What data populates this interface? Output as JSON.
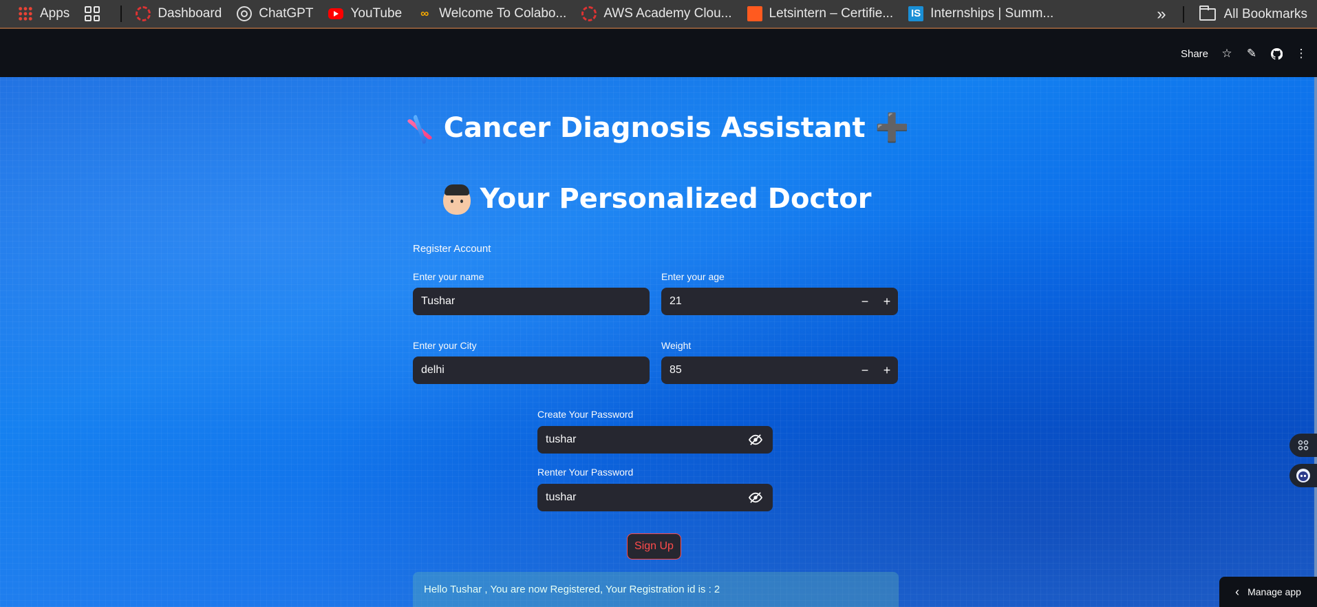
{
  "bookmarks": {
    "items": [
      {
        "label": "Apps",
        "icon": "apps-grid-icon"
      },
      {
        "label": "Dashboard",
        "icon": "dashboard-ring-icon"
      },
      {
        "label": "ChatGPT",
        "icon": "chatgpt-icon"
      },
      {
        "label": "YouTube",
        "icon": "youtube-icon"
      },
      {
        "label": "Welcome To Colabo...",
        "icon": "colab-icon"
      },
      {
        "label": "AWS Academy Clou...",
        "icon": "aws-academy-icon"
      },
      {
        "label": "Letsintern – Certifie...",
        "icon": "letsintern-icon"
      },
      {
        "label": "Internships | Summ...",
        "icon": "internshala-icon"
      }
    ],
    "all_bookmarks": "All Bookmarks"
  },
  "header": {
    "share": "Share"
  },
  "app": {
    "title": "Cancer Diagnosis Assistant ➕",
    "subtitle": "Your Personalized Doctor",
    "form_title": "Register Account",
    "name_label": "Enter your name",
    "name_value": "Tushar",
    "age_label": "Enter your age",
    "age_value": "21",
    "city_label": "Enter your City",
    "city_value": "delhi",
    "weight_label": "Weight",
    "weight_value": "85",
    "password_label": "Create Your Password",
    "password_value": "tushar",
    "repassword_label": "Renter Your Password",
    "repassword_value": "tushar",
    "signup_label": "Sign Up",
    "success_message": "Hello Tushar , You are now Registered, Your Registration id is : 2"
  },
  "footer": {
    "manage_app": "Manage app"
  },
  "colors": {
    "primary": "#ff4b4b",
    "input_bg": "#262730",
    "header_bg": "#0e1117",
    "background_blue": "#1380f0"
  }
}
